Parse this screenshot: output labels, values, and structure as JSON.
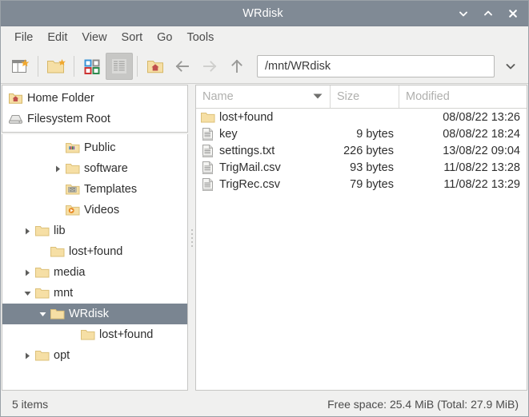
{
  "window": {
    "title": "WRdisk",
    "buttons": [
      {
        "name": "minimize",
        "glyph": "chevron-down"
      },
      {
        "name": "maximize",
        "glyph": "chevron-up"
      },
      {
        "name": "close",
        "glyph": "x"
      }
    ]
  },
  "menubar": {
    "items": [
      "File",
      "Edit",
      "View",
      "Sort",
      "Go",
      "Tools"
    ]
  },
  "toolbar": {
    "new_tab_label": "",
    "new_folder_label": "",
    "icon_view_label": "",
    "detailed_view_label": "",
    "home_label": "",
    "back_label": "",
    "forward_label": "",
    "up_label": "",
    "path_value": "/mnt/WRdisk",
    "path_placeholder": "/mnt/WRdisk"
  },
  "sidebar": {
    "places": [
      {
        "label": "Home Folder",
        "icon": "home-folder-icon"
      },
      {
        "label": "Filesystem Root",
        "icon": "drive-icon"
      }
    ],
    "tree": [
      {
        "label": "Public",
        "indent": 3,
        "twisty": "none",
        "icon": "folder-public-icon",
        "selected": false
      },
      {
        "label": "software",
        "indent": 3,
        "twisty": "collapsed",
        "icon": "folder-icon",
        "selected": false
      },
      {
        "label": "Templates",
        "indent": 3,
        "twisty": "none",
        "icon": "folder-templates-icon",
        "selected": false
      },
      {
        "label": "Videos",
        "indent": 3,
        "twisty": "none",
        "icon": "folder-videos-icon",
        "selected": false
      },
      {
        "label": "lib",
        "indent": 1,
        "twisty": "collapsed",
        "icon": "folder-icon",
        "selected": false
      },
      {
        "label": "lost+found",
        "indent": 2,
        "twisty": "none",
        "icon": "folder-icon",
        "selected": false
      },
      {
        "label": "media",
        "indent": 1,
        "twisty": "collapsed",
        "icon": "folder-icon",
        "selected": false
      },
      {
        "label": "mnt",
        "indent": 1,
        "twisty": "expanded",
        "icon": "folder-icon",
        "selected": false
      },
      {
        "label": "WRdisk",
        "indent": 2,
        "twisty": "expanded",
        "icon": "folder-icon",
        "selected": true
      },
      {
        "label": "lost+found",
        "indent": 4,
        "twisty": "none",
        "icon": "folder-icon",
        "selected": false
      },
      {
        "label": "opt",
        "indent": 1,
        "twisty": "collapsed",
        "icon": "folder-icon",
        "selected": false
      }
    ]
  },
  "filelist": {
    "columns": [
      {
        "key": "name",
        "label": "Name",
        "sorted": true,
        "sort_dir": "desc"
      },
      {
        "key": "size",
        "label": "Size",
        "sorted": false
      },
      {
        "key": "modified",
        "label": "Modified",
        "sorted": false
      }
    ],
    "rows": [
      {
        "name": "lost+found",
        "size": "",
        "modified": "08/08/22 13:26",
        "icon": "folder-icon"
      },
      {
        "name": "key",
        "size": "9 bytes",
        "modified": "08/08/22 18:24",
        "icon": "text-file-icon"
      },
      {
        "name": "settings.txt",
        "size": "226 bytes",
        "modified": "13/08/22 09:04",
        "icon": "text-file-icon"
      },
      {
        "name": "TrigMail.csv",
        "size": "93 bytes",
        "modified": "11/08/22 13:28",
        "icon": "text-file-icon"
      },
      {
        "name": "TrigRec.csv",
        "size": "79 bytes",
        "modified": "11/08/22 13:29",
        "icon": "text-file-icon"
      }
    ]
  },
  "statusbar": {
    "item_count": "5 items",
    "free_space": "Free space: 25.4 MiB (Total: 27.9 MiB)"
  },
  "colors": {
    "titlebar": "#808a95",
    "selection": "#7a8591",
    "chrome": "#f0f0ef",
    "folder_fill": "#f5dfa4",
    "folder_stroke": "#d9b968",
    "text": "#2e2e2e"
  }
}
